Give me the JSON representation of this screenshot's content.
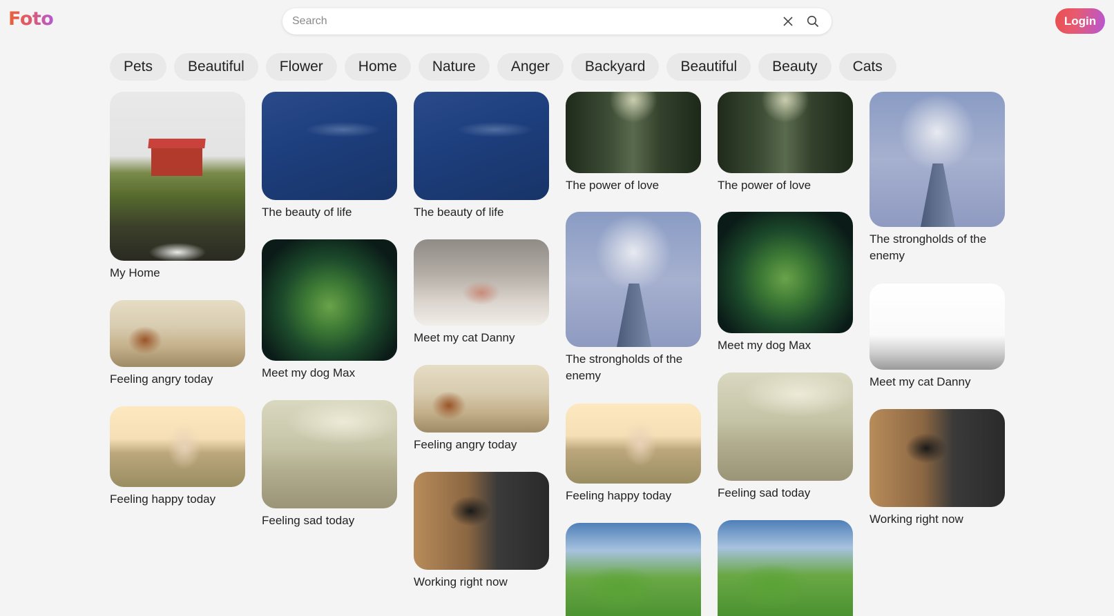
{
  "app": {
    "logo": "Foto"
  },
  "header": {
    "search": {
      "placeholder": "Search",
      "value": "",
      "clear_icon": "close-icon",
      "search_icon": "search-icon"
    },
    "login_label": "Login"
  },
  "categories": [
    "Pets",
    "Beautiful",
    "Flower",
    "Home",
    "Nature",
    "Anger",
    "Backyard",
    "Beautiful",
    "Beauty",
    "Cats"
  ],
  "columns": [
    [
      {
        "caption": "My Home"
      },
      {
        "caption": "Feeling angry today"
      },
      {
        "caption": "Feeling happy today"
      }
    ],
    [
      {
        "caption": "The beauty of life"
      },
      {
        "caption": "Meet my dog Max"
      },
      {
        "caption": "Feeling sad today"
      }
    ],
    [
      {
        "caption": "The beauty of life"
      },
      {
        "caption": "Meet my cat Danny"
      },
      {
        "caption": "Feeling angry today"
      },
      {
        "caption": "Working right now"
      }
    ],
    [
      {
        "caption": "The power of love"
      },
      {
        "caption": "The strongholds of the enemy"
      },
      {
        "caption": "Feeling happy today"
      },
      {
        "caption": ""
      }
    ],
    [
      {
        "caption": "The power of love"
      },
      {
        "caption": "Meet my dog Max"
      },
      {
        "caption": "Feeling sad today"
      },
      {
        "caption": ""
      }
    ],
    [
      {
        "caption": "The strongholds of the enemy"
      },
      {
        "caption": "Meet my cat Danny"
      },
      {
        "caption": "Working right now"
      }
    ]
  ]
}
